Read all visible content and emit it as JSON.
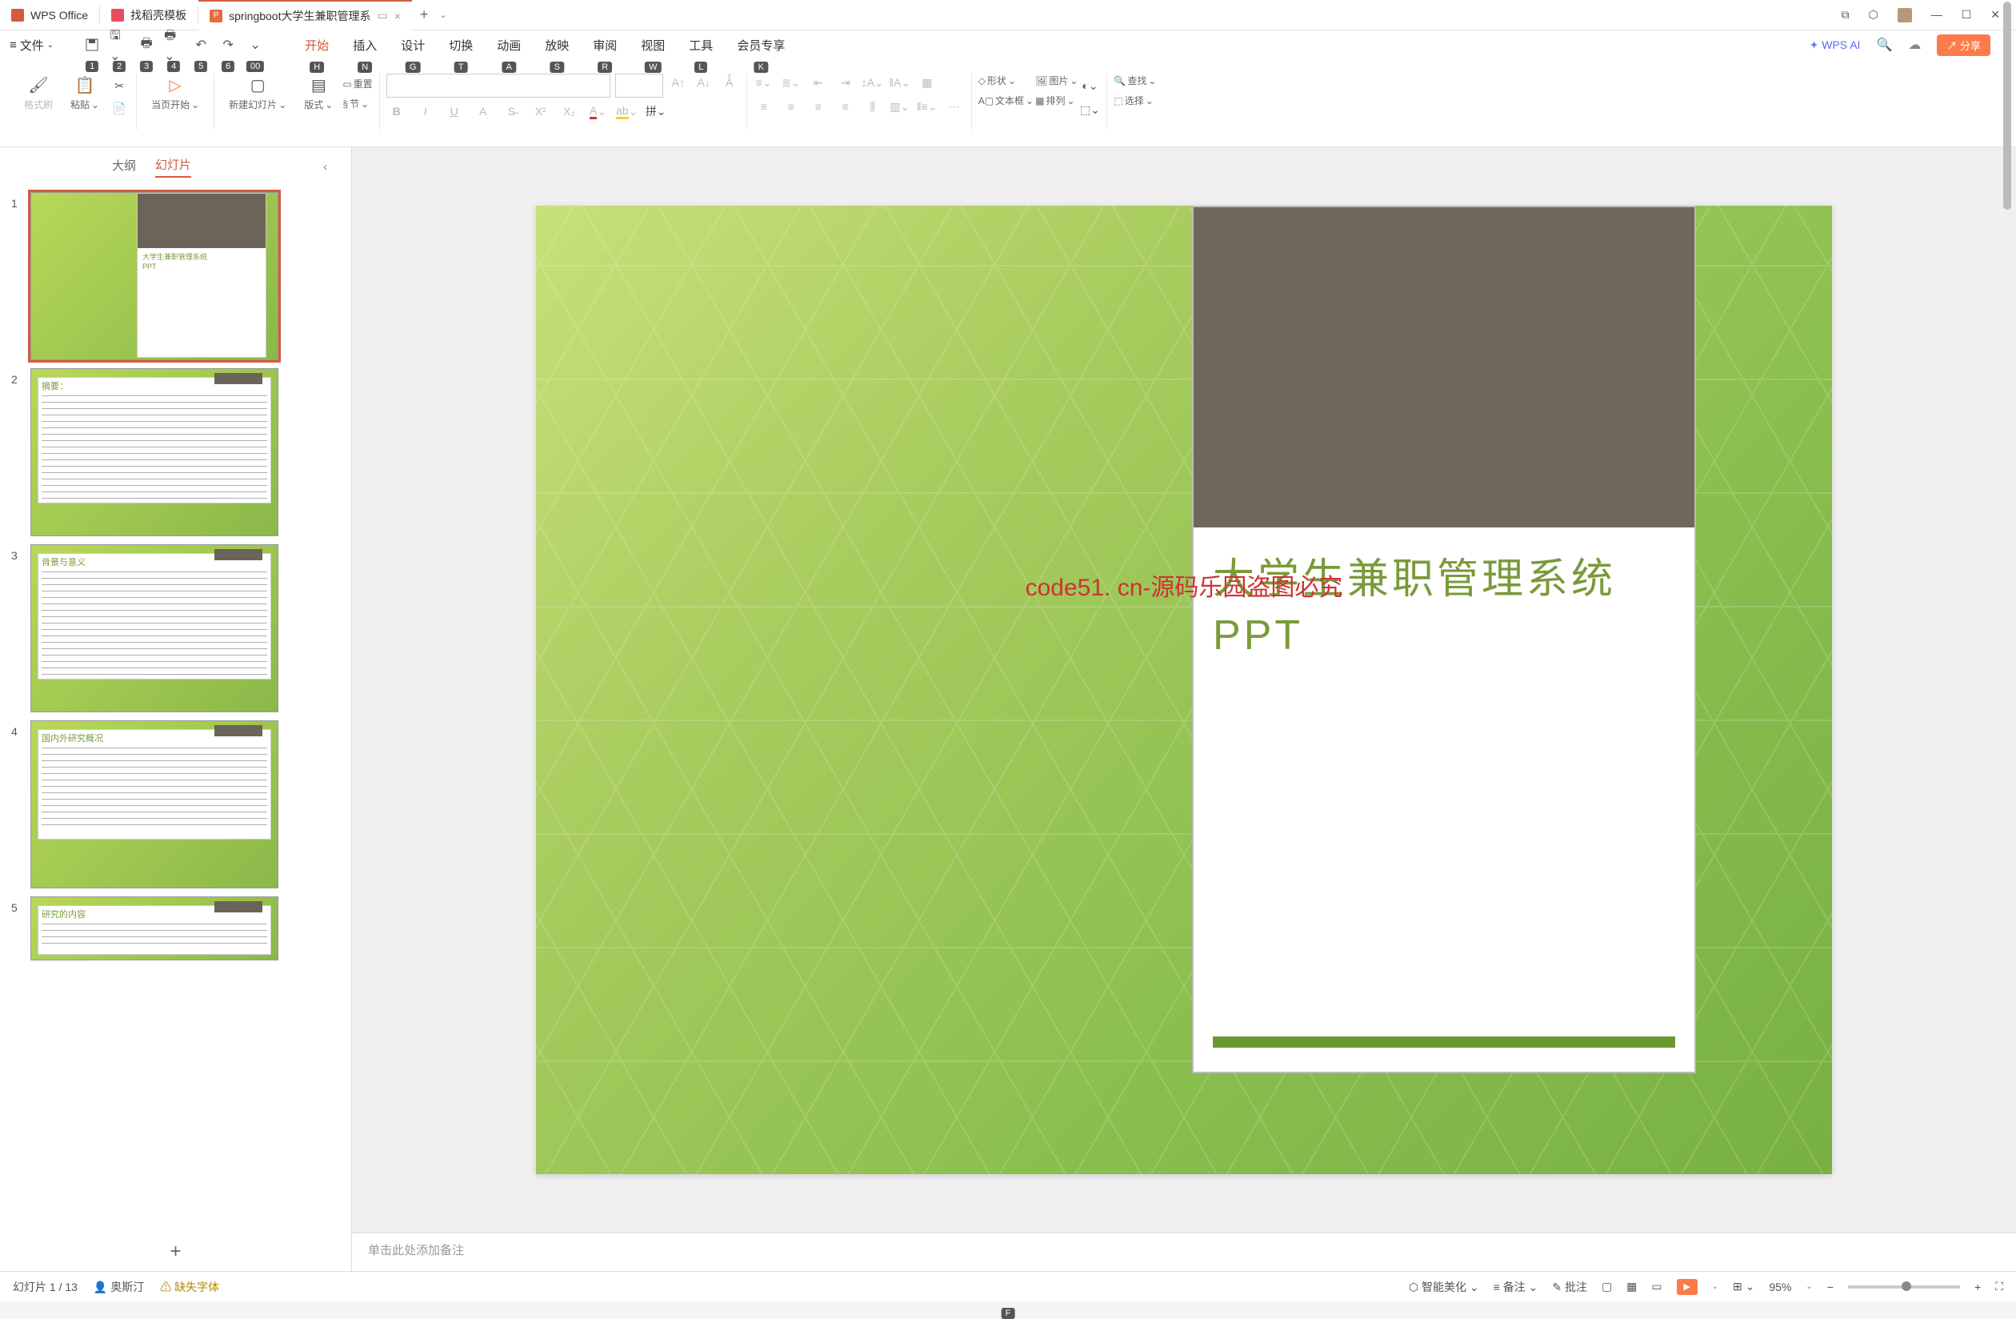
{
  "tabs": {
    "t1": "WPS Office",
    "t2": "找稻壳模板",
    "t3": "springboot大学生兼职管理系"
  },
  "file_menu": "文件",
  "keys": {
    "file": "F",
    "q1": "1",
    "q2": "2",
    "q3": "3",
    "q4": "4",
    "q5": "5",
    "q6": "6",
    "q7": "00",
    "home": "H",
    "insert": "N",
    "design": "G",
    "trans": "T",
    "anim": "A",
    "show": "S",
    "review": "R",
    "view": "W",
    "tool": "L",
    "vip": "K"
  },
  "menu": {
    "home": "开始",
    "insert": "插入",
    "design": "设计",
    "trans": "切换",
    "anim": "动画",
    "show": "放映",
    "review": "审阅",
    "view": "视图",
    "tool": "工具",
    "vip": "会员专享"
  },
  "ai": "WPS AI",
  "share": "分享",
  "ribbon": {
    "format_painter": "格式刷",
    "paste": "粘贴",
    "from_current": "当页开始",
    "new_slide": "新建幻灯片",
    "layout": "版式",
    "reset": "重置",
    "section": "节",
    "shape": "形状",
    "picture": "图片",
    "textbox": "文本框",
    "arrange": "排列",
    "find": "查找",
    "select": "选择"
  },
  "sidetab": {
    "outline": "大纲",
    "slides": "幻灯片"
  },
  "thumbs": {
    "t1_title": "大学生兼职管理系统\nPPT",
    "t2_title": "摘要：",
    "t3_title": "背景与意义",
    "t4_title": "国内外研究概况",
    "t5_title": "研究的内容"
  },
  "watermark": "code51. cn-源码乐园盗图必究",
  "slide": {
    "title_l1": "大学生兼职管理系统",
    "title_l2": "PPT"
  },
  "notes_placeholder": "单击此处添加备注",
  "status": {
    "page": "幻灯片 1 / 13",
    "author": "奥斯汀",
    "missing": "缺失字体",
    "beautify": "智能美化",
    "notes": "备注",
    "comments": "批注",
    "zoom": "95%"
  }
}
